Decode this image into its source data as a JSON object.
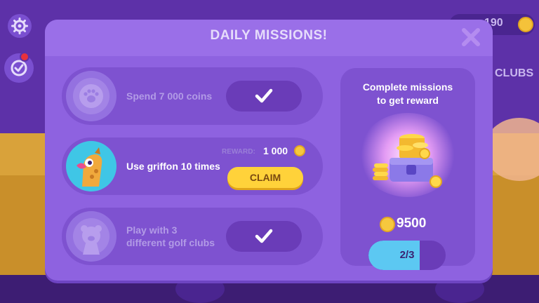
{
  "hud": {
    "coin_count": "190",
    "side_label": "CLUBS"
  },
  "dialog": {
    "title": "DAILY MISSIONS!"
  },
  "missions": [
    {
      "line1": "Spend 7 000 coins",
      "line2": "",
      "state": "completed"
    },
    {
      "line1": "Use griffon 10 times",
      "line2": "",
      "state": "claimable",
      "reward_label": "REWARD:",
      "reward_value": "1 000",
      "claim_label": "CLAIM"
    },
    {
      "line1": "Play with 3",
      "line2": "different golf clubs",
      "state": "completed"
    }
  ],
  "reward_panel": {
    "title_line1": "Complete missions",
    "title_line2": "to get reward",
    "amount": "9500",
    "progress_text": "2/3",
    "progress": 0.667
  },
  "colors": {
    "accent": "#ffd23a",
    "progress": "#5cc8f2",
    "dialog": "#8e62e0"
  }
}
